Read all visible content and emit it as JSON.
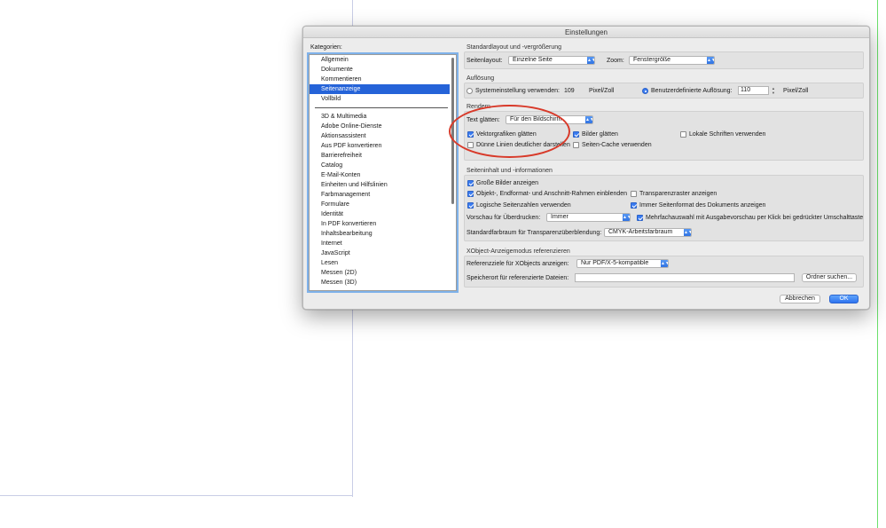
{
  "dialog": {
    "title": "Einstellungen"
  },
  "categories": {
    "title": "Kategorien:",
    "top_items": [
      "Allgemein",
      "Dokumente",
      "Kommentieren",
      "Seitenanzeige",
      "Vollbild"
    ],
    "selected": "Seitenanzeige",
    "items": [
      "3D & Multimedia",
      "Adobe Online-Dienste",
      "Aktionsassistent",
      "Aus PDF konvertieren",
      "Barrierefreiheit",
      "Catalog",
      "E-Mail-Konten",
      "Einheiten und Hilfslinien",
      "Farbmanagement",
      "Formulare",
      "Identität",
      "In PDF konvertieren",
      "Inhaltsbearbeitung",
      "Internet",
      "JavaScript",
      "Lesen",
      "Messen (2D)",
      "Messen (3D)"
    ]
  },
  "layout": {
    "title": "Standardlayout und -vergrößerung",
    "page_layout_label": "Seitenlayout:",
    "page_layout_value": "Einzelne Seite",
    "zoom_label": "Zoom:",
    "zoom_value": "Fenstergröße"
  },
  "resolution": {
    "title": "Auflösung",
    "system_label": "Systemeinstellung verwenden:",
    "system_value": "109",
    "system_unit": "Pixel/Zoll",
    "custom_label": "Benutzerdefinierte Auflösung:",
    "custom_value": "110",
    "custom_unit": "Pixel/Zoll"
  },
  "render": {
    "title": "Rendern",
    "smooth_text_label": "Text glätten:",
    "smooth_text_value": "Für den Bildschirm",
    "vector_label": "Vektorgrafiken glätten",
    "images_label": "Bilder glätten",
    "local_fonts_label": "Lokale Schriften verwenden",
    "thin_lines_label": "Dünne Linien deutlicher darstellen",
    "page_cache_label": "Seiten-Cache verwenden"
  },
  "content": {
    "title": "Seiteninhalt und -informationen",
    "large_images_label": "Große Bilder anzeigen",
    "frames_label": "Objekt-, Endformat- und Anschnitt-Rahmen einblenden",
    "transparency_grid_label": "Transparenzraster anzeigen",
    "logical_pages_label": "Logische Seitenzahlen verwenden",
    "doc_page_format_label": "Immer Seitenformat des Dokuments anzeigen",
    "overprint_label": "Vorschau für Überdrucken:",
    "overprint_value": "Immer",
    "multiselect_label": "Mehrfachauswahl mit Ausgabevorschau per Klick bei gedrückter Umschalttaste",
    "color_space_label": "Standardfarbraum für Transparenzüberblendung:",
    "color_space_value": "CMYK-Arbeitsfarbraum"
  },
  "xobject": {
    "title": "XObject-Anzeigemodus referenzieren",
    "targets_label": "Referenzziele für XObjects anzeigen:",
    "targets_value": "Nur PDF/X-5-kompatible",
    "location_label": "Speicherort für referenzierte Dateien:",
    "location_value": "",
    "browse_button": "Ordner suchen..."
  },
  "footer": {
    "cancel": "Abbrechen",
    "ok": "OK"
  },
  "colors": {
    "accent": "#2563d8",
    "annotation": "#d83a2a"
  },
  "icons": {
    "select_arrow": "chevron-updown-icon",
    "stepper": "stepper-icon"
  }
}
